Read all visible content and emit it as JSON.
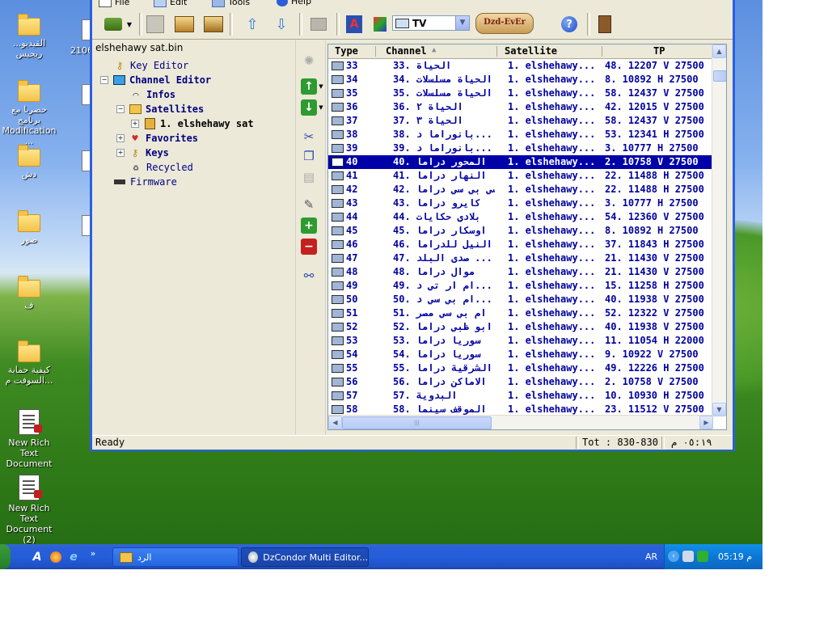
{
  "desktop": {
    "icons": [
      {
        "label": "...القيديو ريجيس"
      },
      {
        "label": "حصريا مع برنامج Modification ..."
      },
      {
        "label": "دش"
      },
      {
        "label": "صور"
      },
      {
        "label": "ف"
      },
      {
        "label": "كيفية حماية السوفت م..."
      },
      {
        "label": "New Rich Text Document"
      },
      {
        "label": "New Rich Text Document (2)"
      }
    ],
    "partial_label": "2106"
  },
  "window": {
    "menu": [
      "File",
      "Edit",
      "Tools",
      "Help"
    ],
    "filter_value": "TV",
    "logo_text": "Dzd-EvEr",
    "file_name": "elshehawy sat.bin",
    "tree": {
      "key_editor": "Key Editor",
      "channel_editor": "Channel Editor",
      "infos": "Infos",
      "satellites": "Satellites",
      "sat1": "1. elshehawy sat",
      "favorites": "Favorites",
      "keys": "Keys",
      "recycled": "Recycled",
      "firmware": "Firmware"
    },
    "grid": {
      "headers": {
        "type": "Type",
        "channel": "Channel",
        "satellite": "Satellite",
        "tp": "TP"
      },
      "sort_arrow": "▲",
      "rows": [
        {
          "num": "33",
          "name": "33. الحياة",
          "sat": "1. elshehawy...",
          "tp": "48. 12207 V 27500"
        },
        {
          "num": "34",
          "name": "34. الحياة مسلسلات",
          "sat": "1. elshehawy...",
          "tp": "8. 10892 H 27500"
        },
        {
          "num": "35",
          "name": "35. الحياة مسلسلات",
          "sat": "1. elshehawy...",
          "tp": "58. 12437 V 27500"
        },
        {
          "num": "36",
          "name": "36. الحياة ٢",
          "sat": "1. elshehawy...",
          "tp": "42. 12015 V 27500"
        },
        {
          "num": "37",
          "name": "37. الحياة ٣",
          "sat": "1. elshehawy...",
          "tp": "58. 12437 V 27500"
        },
        {
          "num": "38",
          "name": "38. بانوراما د...",
          "sat": "1. elshehawy...",
          "tp": "53. 12341 H 27500"
        },
        {
          "num": "39",
          "name": "39. بانوراما د...",
          "sat": "1. elshehawy...",
          "tp": "3. 10777 H 27500"
        },
        {
          "num": "40",
          "name": "40. المحور دراما",
          "sat": "1. elshehawy...",
          "tp": "2. 10758 V 27500",
          "selected": true
        },
        {
          "num": "41",
          "name": "41. النهار دراما",
          "sat": "1. elshehawy...",
          "tp": "22. 11488 H 27500"
        },
        {
          "num": "42",
          "name": "42. سي بي سي دراما",
          "sat": "1. elshehawy...",
          "tp": "22. 11488 H 27500"
        },
        {
          "num": "43",
          "name": "43. كايرو دراما",
          "sat": "1. elshehawy...",
          "tp": "3. 10777 H 27500"
        },
        {
          "num": "44",
          "name": "44. بلادي حكايات",
          "sat": "1. elshehawy...",
          "tp": "54. 12360 V 27500"
        },
        {
          "num": "45",
          "name": "45. اوسكار دراما",
          "sat": "1. elshehawy...",
          "tp": "8. 10892 H 27500"
        },
        {
          "num": "46",
          "name": "46. النيل للدراما",
          "sat": "1. elshehawy...",
          "tp": "37. 11843 H 27500"
        },
        {
          "num": "47",
          "name": "47. صدى البلد ...",
          "sat": "1. elshehawy...",
          "tp": "21. 11430 V 27500"
        },
        {
          "num": "48",
          "name": "48. موال دراما",
          "sat": "1. elshehawy...",
          "tp": "21. 11430 V 27500"
        },
        {
          "num": "49",
          "name": "49. ام ار تي د...",
          "sat": "1. elshehawy...",
          "tp": "15. 11258 H 27500"
        },
        {
          "num": "50",
          "name": "50. ام بي سي د...",
          "sat": "1. elshehawy...",
          "tp": "40. 11938 V 27500"
        },
        {
          "num": "51",
          "name": "51. ام بي سي مصر",
          "sat": "1. elshehawy...",
          "tp": "52. 12322 V 27500"
        },
        {
          "num": "52",
          "name": "52. ابو ظبي دراما",
          "sat": "1. elshehawy...",
          "tp": "40. 11938 V 27500"
        },
        {
          "num": "53",
          "name": "53. سوريا دراما",
          "sat": "1. elshehawy...",
          "tp": "11. 11054 H 22000"
        },
        {
          "num": "54",
          "name": "54. سوريا دراما",
          "sat": "1. elshehawy...",
          "tp": "9. 10922 V 27500"
        },
        {
          "num": "55",
          "name": "55. الشرقية دراما",
          "sat": "1. elshehawy...",
          "tp": "49. 12226 H 27500"
        },
        {
          "num": "56",
          "name": "56. الاماكن دراما",
          "sat": "1. elshehawy...",
          "tp": "2. 10758 V 27500"
        },
        {
          "num": "57",
          "name": "57. البدوية",
          "sat": "1. elshehawy...",
          "tp": "10. 10930 H 27500"
        },
        {
          "num": "58",
          "name": "58. الموقف سينما",
          "sat": "1. elshehawy...",
          "tp": "23. 11512 V 27500"
        }
      ]
    },
    "status": {
      "text": "Ready",
      "total": "Tot : 830-830",
      "time": "٠٥:١٩ م"
    }
  },
  "taskbar": {
    "quick_launch_more": "»",
    "buttons": [
      {
        "label": "الرد"
      },
      {
        "label": "DzCondor Multi Editor..."
      }
    ],
    "lang": "AR",
    "clock": "05:19 م"
  },
  "colors": {
    "selection": "#0000a8",
    "row_text": "#0000a0",
    "titlebar": "#0a42d4",
    "taskbar": "#245edb"
  }
}
